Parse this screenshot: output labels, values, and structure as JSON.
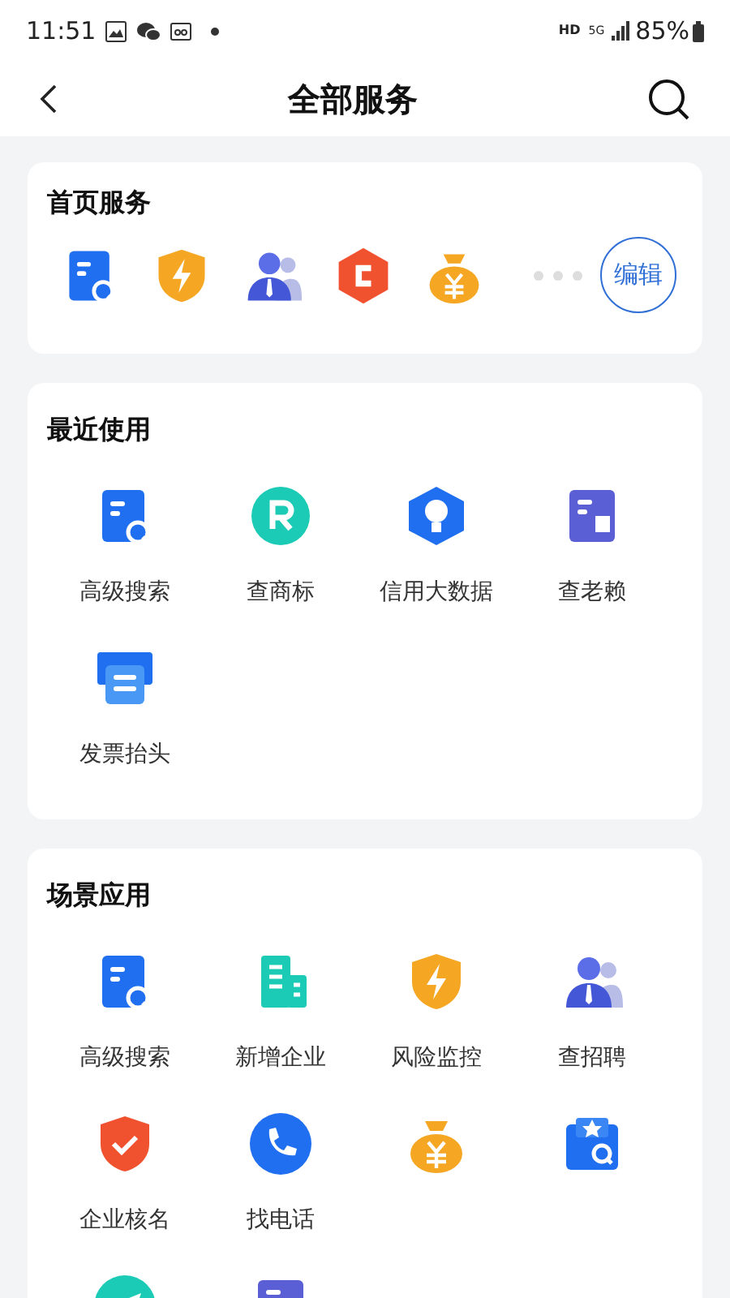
{
  "status_bar": {
    "time": "11:51",
    "network": "HD",
    "signal_type": "5G",
    "battery": "85%"
  },
  "nav": {
    "title": "全部服务"
  },
  "home_services": {
    "title": "首页服务",
    "icons": [
      {
        "kind": "search-doc"
      },
      {
        "kind": "risk"
      },
      {
        "kind": "recruit"
      },
      {
        "kind": "c-hex"
      },
      {
        "kind": "money"
      }
    ],
    "edit_button": "编辑"
  },
  "sections": [
    {
      "title": "最近使用",
      "items": [
        {
          "kind": "search-doc",
          "label": "高级搜索"
        },
        {
          "kind": "trademark",
          "label": "查商标"
        },
        {
          "kind": "credit",
          "label": "信用大数据"
        },
        {
          "kind": "debtor",
          "label": "查老赖"
        },
        {
          "kind": "invoice",
          "label": "发票抬头"
        }
      ]
    },
    {
      "title": "场景应用",
      "items": [
        {
          "kind": "search-doc",
          "label": "高级搜索"
        },
        {
          "kind": "building",
          "label": "新增企业"
        },
        {
          "kind": "risk",
          "label": "风险监控"
        },
        {
          "kind": "recruit",
          "label": "查招聘"
        },
        {
          "kind": "verify",
          "label": "企业核名"
        },
        {
          "kind": "phone",
          "label": "找电话"
        },
        {
          "kind": "money"
        },
        {
          "kind": "star-search"
        },
        {
          "kind": "send"
        },
        {
          "kind": "doc-purple"
        }
      ]
    }
  ]
}
